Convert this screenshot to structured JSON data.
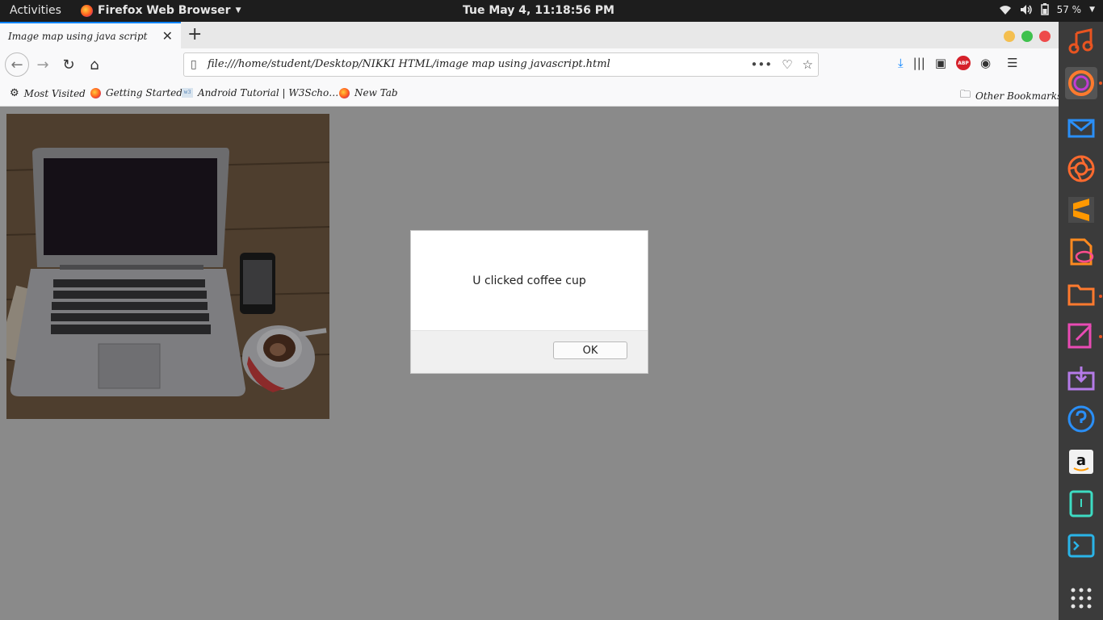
{
  "topbar": {
    "activities": "Activities",
    "app_name": "Firefox Web Browser",
    "clock": "Tue May  4, 11:18:56 PM",
    "battery": "57 %"
  },
  "browser": {
    "tab_title": "Image map using java script",
    "url": "file:///home/student/Desktop/NIKKI HTML/image map using javascript.html",
    "bookmarks": [
      "Most Visited",
      "Getting Started",
      "Android Tutorial | W3Scho…",
      "New Tab"
    ],
    "other_bookmarks": "Other Bookmarks"
  },
  "dialog": {
    "message": "U clicked coffee cup",
    "ok_label": "OK"
  },
  "dock": {
    "items": [
      "music-icon",
      "firefox-icon",
      "mail-icon",
      "aperture-icon",
      "sublime-icon",
      "document-viewer-icon",
      "files-icon",
      "text-editor-icon",
      "software-install-icon",
      "help-icon",
      "amazon-icon",
      "usb-icon",
      "terminal-icon",
      "app-grid-icon"
    ]
  },
  "colors": {
    "accent": "#0a84ff",
    "ubuntu_orange": "#e95420",
    "dim_overlay": "#8a8a8a"
  }
}
